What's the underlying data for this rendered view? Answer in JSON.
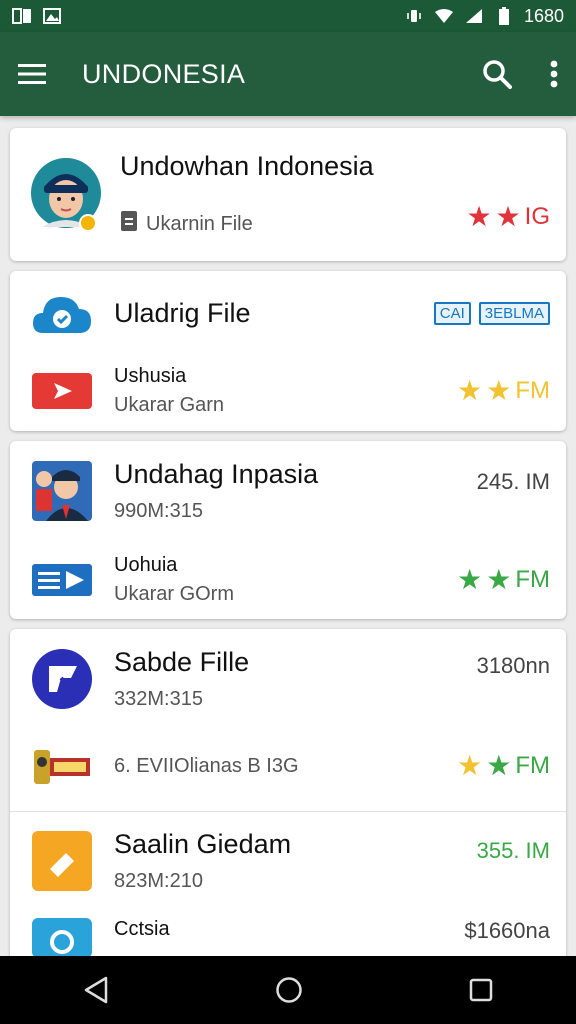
{
  "status_bar": {
    "left_icons": [
      "sim-icon",
      "image-icon"
    ],
    "right_icons": [
      "vibrate-icon",
      "wifi-icon",
      "signal-icon",
      "battery-icon"
    ],
    "time": "1680"
  },
  "app_bar": {
    "title": "UNDONESIA",
    "menu_icon": "menu-icon",
    "search_icon": "search-icon",
    "more_icon": "more-vertical-icon"
  },
  "cards": [
    {
      "title": "Undowhan Indonesia",
      "subtitle": "Ukarnin File",
      "trailing": "IG",
      "stars": [
        "#e0333b",
        "#e0333b"
      ],
      "trailing_color": "#e0333b"
    },
    {
      "title": "Uladrig File",
      "badges": [
        "CAI",
        "3EBLMA"
      ],
      "item_title": "Ushusia",
      "item_sub": "Ukarar Garn",
      "trailing": "FM",
      "stars": [
        "#f2c230",
        "#f2c230"
      ],
      "trailing_color": "#f2c230"
    },
    {
      "title": "Undahag Inpasia",
      "size_line": "990M:315",
      "meta": "245. IM",
      "item_title": "Uohuia",
      "item_sub": "Ukarar GOrm",
      "trailing": "FM",
      "stars": [
        "#3aa845",
        "#3aa845"
      ],
      "trailing_color": "#3aa845"
    },
    {
      "title": "Sabde Fille",
      "size_line": "332M:315",
      "meta": "3180nn",
      "item_line": "6. EVIIOlianas B I3G",
      "trailing": "FM",
      "stars": [
        "#f2c230",
        "#3aa845"
      ],
      "trailing_color": "#3aa845",
      "second_title": "Saalin Giedam",
      "second_size": "823M:210",
      "second_meta": "355. IM",
      "third_title": "Cctsia",
      "third_meta": "$1660na"
    }
  ],
  "nav_bar": {
    "back": "back-triangle-icon",
    "home": "home-circle-icon",
    "recents": "recents-square-icon"
  }
}
